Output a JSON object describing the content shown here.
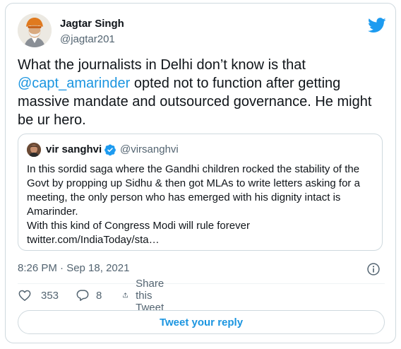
{
  "tweet": {
    "author_name": "Jagtar Singh",
    "author_handle": "@jagtar201",
    "text_line1": "What the journalists in Delhi don’t know is that",
    "mention": "@capt_amarinder",
    "text_line2_rest": " opted not to function after getting",
    "text_line3": "massive mandate and outsourced governance. He might",
    "text_line4": "be ur hero.",
    "timestamp": "8:26 PM · Sep 18, 2021",
    "like_count": "353",
    "reply_count": "8",
    "share_label": "Share this Tweet",
    "reply_button_label": "Tweet your reply"
  },
  "quoted_tweet": {
    "author_name": "vir sanghvi",
    "author_handle": "@virsanghvi",
    "lines": [
      "In this sordid saga where the Gandhi children rocked the stability of the",
      "Govt by propping up Sidhu & then got MLAs to write letters asking for a",
      "meeting, the only person who has emerged with his dignity intact is",
      "Amarinder.",
      "With this kind of Congress Modi will rule forever",
      "twitter.com/IndiaToday/sta…"
    ]
  },
  "icons": {
    "brand": "twitter-bird-icon",
    "verified": "verified-badge-icon",
    "info": "info-icon",
    "like": "heart-icon",
    "reply": "reply-bubble-icon",
    "share": "share-icon"
  },
  "colors": {
    "accent": "#1b95e0",
    "text": "#0f1419",
    "secondary": "#536471",
    "border": "#cfd9de"
  }
}
